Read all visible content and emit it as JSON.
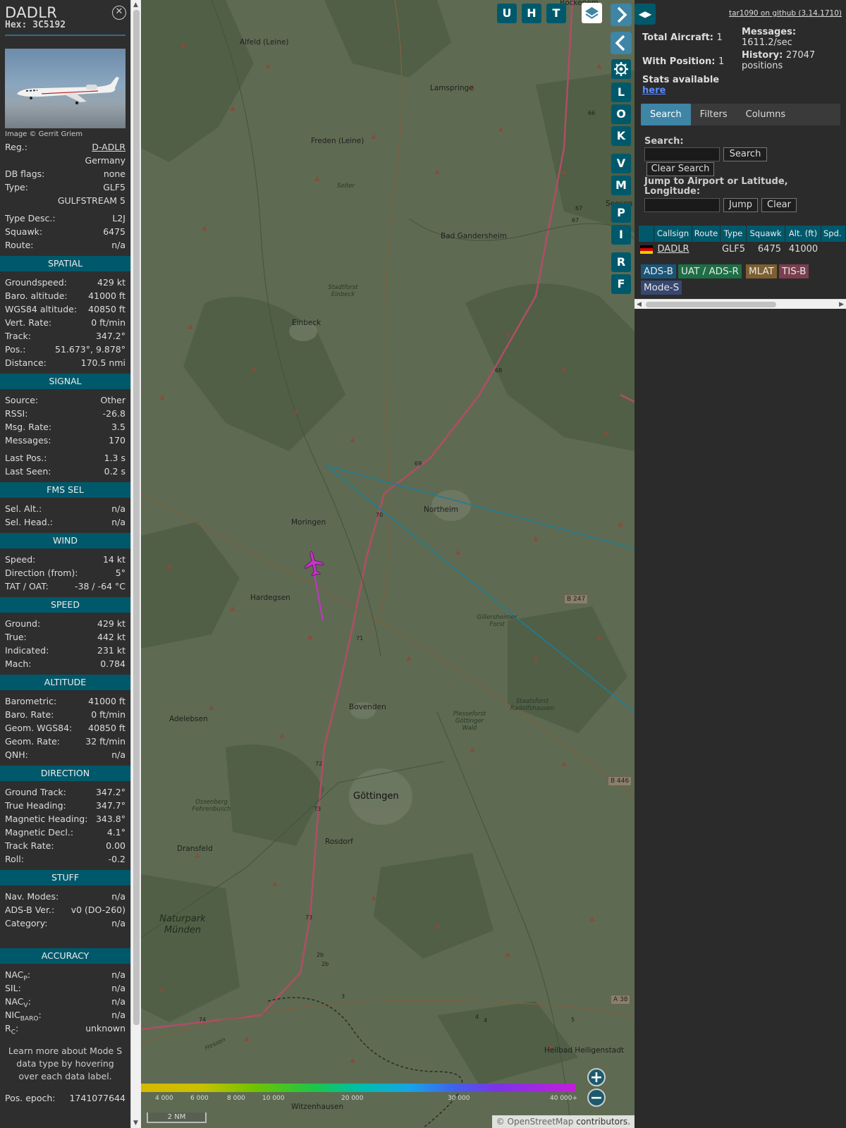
{
  "sidebar": {
    "title": "DADLR",
    "hex_label": "Hex:",
    "hex": "3C5192",
    "photo_credit": "Image © Gerrit Griem",
    "info": [
      {
        "label": "Reg.:",
        "value": "D-ADLR",
        "link": true
      },
      {
        "label": "",
        "value": "Germany"
      },
      {
        "label": "DB flags:",
        "value": "none"
      },
      {
        "label": "Type:",
        "value": "GLF5"
      },
      {
        "label": "",
        "value": "GULFSTREAM 5"
      },
      {
        "gap": true
      },
      {
        "label": "Type Desc.:",
        "value": "L2J"
      },
      {
        "label": "Squawk:",
        "value": "6475"
      },
      {
        "label": "Route:",
        "value": "n/a"
      }
    ],
    "sections": [
      {
        "title": "SPATIAL",
        "rows": [
          {
            "label": "Groundspeed:",
            "value": "429 kt"
          },
          {
            "label": "Baro. altitude:",
            "value": "41000 ft"
          },
          {
            "label": "WGS84 altitude:",
            "value": "40850 ft"
          },
          {
            "label": "Vert. Rate:",
            "value": "0 ft/min"
          },
          {
            "label": "Track:",
            "value": "347.2°"
          },
          {
            "label": "Pos.:",
            "value": "51.673°, 9.878°"
          },
          {
            "label": "Distance:",
            "value": "170.5 nmi"
          }
        ]
      },
      {
        "title": "SIGNAL",
        "rows": [
          {
            "label": "Source:",
            "value": "Other"
          },
          {
            "label": "RSSI:",
            "value": "-26.8"
          },
          {
            "label": "Msg. Rate:",
            "value": "3.5"
          },
          {
            "label": "Messages:",
            "value": "170"
          },
          {
            "gap": true
          },
          {
            "label": "Last Pos.:",
            "value": "1.3 s"
          },
          {
            "label": "Last Seen:",
            "value": "0.2 s"
          }
        ]
      },
      {
        "title": "FMS SEL",
        "rows": [
          {
            "label": "Sel. Alt.:",
            "value": "n/a"
          },
          {
            "label": "Sel. Head.:",
            "value": "n/a"
          }
        ]
      },
      {
        "title": "WIND",
        "rows": [
          {
            "label": "Speed:",
            "value": "14 kt"
          },
          {
            "label": "Direction (from):",
            "value": "5°"
          },
          {
            "label": "TAT / OAT:",
            "value": "-38 / -64 °C"
          }
        ]
      },
      {
        "title": "SPEED",
        "rows": [
          {
            "label": "Ground:",
            "value": "429 kt"
          },
          {
            "label": "True:",
            "value": "442 kt"
          },
          {
            "label": "Indicated:",
            "value": "231 kt"
          },
          {
            "label": "Mach:",
            "value": "0.784"
          }
        ]
      },
      {
        "title": "ALTITUDE",
        "rows": [
          {
            "label": "Barometric:",
            "value": "41000 ft"
          },
          {
            "label": "Baro. Rate:",
            "value": "0 ft/min"
          },
          {
            "label": "Geom. WGS84:",
            "value": "40850 ft"
          },
          {
            "label": "Geom. Rate:",
            "value": "32 ft/min"
          },
          {
            "label": "QNH:",
            "value": "n/a"
          }
        ]
      },
      {
        "title": "DIRECTION",
        "rows": [
          {
            "label": "Ground Track:",
            "value": "347.2°"
          },
          {
            "label": "True Heading:",
            "value": "347.7°"
          },
          {
            "label": "Magnetic Heading:",
            "value": "343.8°"
          },
          {
            "label": "Magnetic Decl.:",
            "value": "4.1°"
          },
          {
            "label": "Track Rate:",
            "value": "0.00"
          },
          {
            "label": "Roll:",
            "value": "-0.2"
          }
        ]
      },
      {
        "title": "STUFF",
        "rows": [
          {
            "label": "Nav. Modes:",
            "value": "n/a"
          },
          {
            "label": "ADS-B Ver.:",
            "value": "v0 (DO-260)"
          },
          {
            "label": "Category:",
            "value": "n/a"
          }
        ],
        "extra_gap": true
      },
      {
        "title": "ACCURACY",
        "rows": [
          {
            "label": "NACP:",
            "label_main": "NAC",
            "label_sub": "P",
            "value": "n/a"
          },
          {
            "label": "SIL:",
            "value": "n/a"
          },
          {
            "label": "NACV:",
            "label_main": "NAC",
            "label_sub": "V",
            "value": "n/a"
          },
          {
            "label": "NICBARO:",
            "label_main": "NIC",
            "label_sub": "BARO",
            "value": "n/a"
          },
          {
            "label": "RC:",
            "label_main": "R",
            "label_sub": "C",
            "value": "unknown"
          }
        ]
      }
    ],
    "note": "Learn more about Mode S data type by hovering over each data label.",
    "epoch_label": "Pos. epoch:",
    "epoch_value": "1741077644"
  },
  "map": {
    "top_buttons": [
      "U",
      "H",
      "T"
    ],
    "side_buttons": [
      "L",
      "O",
      "K",
      "V",
      "M",
      "P",
      "I",
      "R",
      "F"
    ],
    "places": [
      "Alfeld (Leine)",
      "Lamspringe",
      "Freden (Leine)",
      "Selter",
      "Bad Gandersheim",
      "Stadtforst Einbeck",
      "Einbeck",
      "Northeim",
      "Moringen",
      "Hardegsen",
      "Gillersheimer Forst",
      "Adelebsen",
      "Bovenden",
      "Plesseforst Göttinger Wald",
      "Staatsforst Radolfshausen",
      "Göttingen",
      "Ossenberg Fehrenbusch",
      "Rosdorf",
      "Dransfeld",
      "Naturpark Münden",
      "Witzenhausen",
      "Heilbad Heiligenstadt",
      "Bockenem",
      "Seesen",
      "Hessen"
    ],
    "road_signs": [
      "B 247",
      "B 446",
      "A 38"
    ],
    "road_numbers": [
      "66",
      "67",
      "67",
      "68",
      "69",
      "70",
      "71",
      "72",
      "73",
      "73",
      "74",
      "2b",
      "2b",
      "3",
      "4",
      "4",
      "5"
    ],
    "altitude_scale": [
      "4 000",
      "6 000",
      "8 000",
      "10 000",
      "20 000",
      "30 000",
      "40 000+"
    ],
    "scale_bar": "2 NM",
    "attribution_symbol": "©",
    "attribution_link": "OpenStreetMap",
    "attribution_rest": "contributors."
  },
  "panel": {
    "version": "tar1090 on github (3.14.1710)",
    "total_aircraft_label": "Total Aircraft:",
    "total_aircraft": "1",
    "with_position_label": "With Position:",
    "with_position": "1",
    "messages_label": "Messages:",
    "messages_value": "1611.2/sec",
    "history_label": "History:",
    "history_value": "27047",
    "history_unit": "positions",
    "stats_label": "Stats available",
    "stats_link": "here",
    "tabs": [
      "Search",
      "Filters",
      "Columns"
    ],
    "search_label": "Search:",
    "search_button": "Search",
    "clear_search_button": "Clear Search",
    "jump_label": "Jump to Airport or Latitude, Longitude:",
    "jump_button": "Jump",
    "clear_button": "Clear",
    "table_headers": [
      "",
      "Callsign",
      "Route",
      "Type",
      "Squawk",
      "Alt. (ft)",
      "Spd."
    ],
    "table_row": {
      "callsign": "DADLR",
      "route": "",
      "type": "GLF5",
      "squawk": "6475",
      "alt": "41000",
      "spd": ""
    },
    "badges": [
      {
        "label": "ADS-B",
        "color": "#1a5577"
      },
      {
        "label": "UAT / ADS-R",
        "color": "#1e6e45"
      },
      {
        "label": "MLAT",
        "color": "#7e5f31"
      },
      {
        "label": "TIS-B",
        "color": "#7a3f4f"
      },
      {
        "label": "Mode-S",
        "color": "#374770"
      }
    ]
  },
  "colors": {
    "accent": "#00596b",
    "button_blue": "#3e85a6",
    "track": "#c832c8",
    "range_line": "#1e7d96"
  }
}
